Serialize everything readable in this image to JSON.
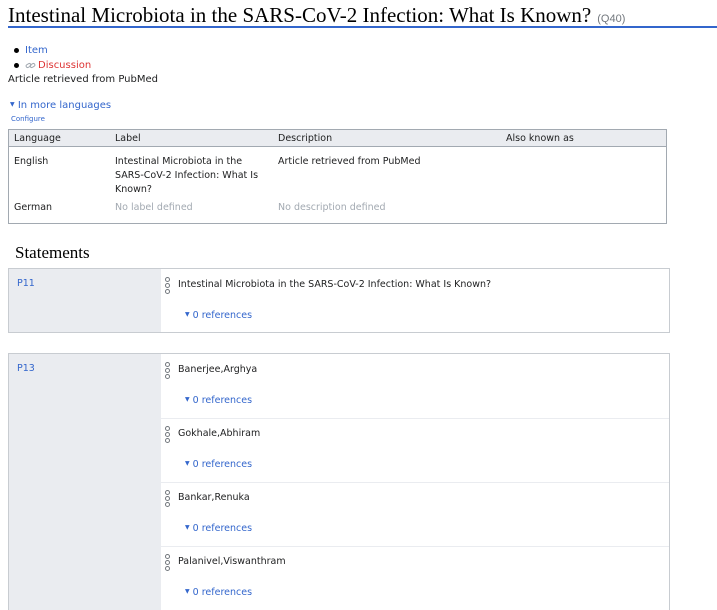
{
  "header": {
    "title": "Intestinal Microbiota in the SARS-CoV-2 Infection: What Is Known?",
    "qid": "(Q40)"
  },
  "tabs": [
    {
      "label": "Item"
    },
    {
      "label": "Discussion"
    }
  ],
  "description": "Article retrieved from PubMed",
  "languages": {
    "toggle": "In more languages",
    "configure": "Configure",
    "headers": [
      "Language",
      "Label",
      "Description",
      "Also known as"
    ],
    "rows": [
      {
        "language": "English",
        "label": "Intestinal Microbiota in the SARS-CoV-2 Infection: What Is Known?",
        "description": "Article retrieved from PubMed",
        "aliases": ""
      },
      {
        "language": "German",
        "label": "No label defined",
        "description": "No description defined",
        "aliases": ""
      }
    ]
  },
  "statements": {
    "heading": "Statements",
    "groups": [
      {
        "property": "P11",
        "values": [
          {
            "text": "Intestinal Microbiota in the SARS-CoV-2 Infection: What Is Known?",
            "refs": "0 references"
          }
        ]
      },
      {
        "property": "P13",
        "values": [
          {
            "text": "Banerjee,Arghya",
            "refs": "0 references"
          },
          {
            "text": "Gokhale,Abhiram",
            "refs": "0 references"
          },
          {
            "text": "Bankar,Renuka",
            "refs": "0 references"
          },
          {
            "text": "Palanivel,Viswanthram",
            "refs": "0 references"
          }
        ]
      }
    ]
  },
  "colors": {
    "link": "#3366cc",
    "red_link": "#dd3333",
    "title_rule": "#3366cc",
    "table_header": "#eaecf0"
  },
  "icons": {
    "discussion": "link-icon",
    "toggle": "triangle-down-icon",
    "rank": "rank-normal-icon"
  }
}
